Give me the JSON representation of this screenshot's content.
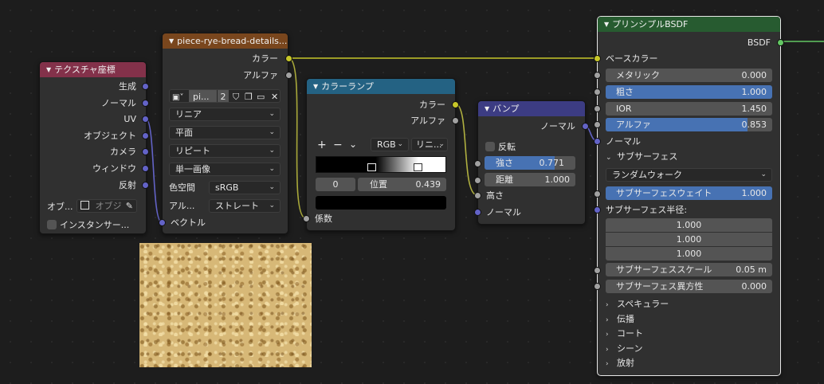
{
  "tex_coord": {
    "title": "テクスチャ座標",
    "outputs": [
      "生成",
      "ノーマル",
      "UV",
      "オブジェクト",
      "カメラ",
      "ウィンドウ",
      "反射"
    ],
    "object_label": "オブ...",
    "object_placeholder": "オブジ",
    "instancer_label": "インスタンサー..."
  },
  "image_tex": {
    "title": "piece-rye-bread-details...",
    "out_color": "カラー",
    "out_alpha": "アルファ",
    "image_name": "pi...",
    "users": "2",
    "interpolation": "リニア",
    "projection": "平面",
    "extension": "リピート",
    "source": "単一画像",
    "colorspace_label": "色空間",
    "colorspace": "sRGB",
    "alpha_label": "アル...",
    "alpha_mode": "ストレート",
    "in_vector": "ベクトル"
  },
  "color_ramp": {
    "title": "カラーランプ",
    "out_color": "カラー",
    "out_alpha": "アルファ",
    "add": "+",
    "remove": "−",
    "color_mode": "RGB",
    "interp": "リニ...",
    "stops": [
      0.3,
      0.439
    ],
    "index": "0",
    "pos_label": "位置",
    "pos_value": "0.439",
    "in_fac": "係数"
  },
  "bump": {
    "title": "バンプ",
    "out_normal": "ノーマル",
    "invert": "反転",
    "strength_label": "強さ",
    "strength": "0.771",
    "strength_fraction": 0.771,
    "distance_label": "距離",
    "distance": "1.000",
    "in_height": "高さ",
    "in_normal": "ノーマル"
  },
  "bsdf": {
    "title": "プリンシプルBSDF",
    "out": "BSDF",
    "base_color": "ベースカラー",
    "metallic_label": "メタリック",
    "metallic": "0.000",
    "roughness_label": "粗さ",
    "roughness": "1.000",
    "ior_label": "IOR",
    "ior": "1.450",
    "alpha_label": "アルファ",
    "alpha": "0.853",
    "normal": "ノーマル",
    "subsurface": "サブサーフェス",
    "ss_method": "ランダムウォーク",
    "ss_weight_label": "サブサーフェスウェイト",
    "ss_weight": "1.000",
    "ss_radius_label": "サブサーフェス半径:",
    "ss_radius": [
      "1.000",
      "1.000",
      "1.000"
    ],
    "ss_scale_label": "サブサーフェススケール",
    "ss_scale": "0.05 m",
    "ss_aniso_label": "サブサーフェス異方性",
    "ss_aniso": "0.000",
    "collapsed": [
      "スペキュラー",
      "伝播",
      "コート",
      "シーン",
      "放射"
    ]
  },
  "colors": {
    "bg": "#1d1d1d",
    "node": "#303030",
    "accent_fill": "#4772b3",
    "vector_socket": "#6363c7",
    "color_socket": "#c7c729",
    "float_socket": "#a1a1a1",
    "shader_socket": "#63c763"
  }
}
